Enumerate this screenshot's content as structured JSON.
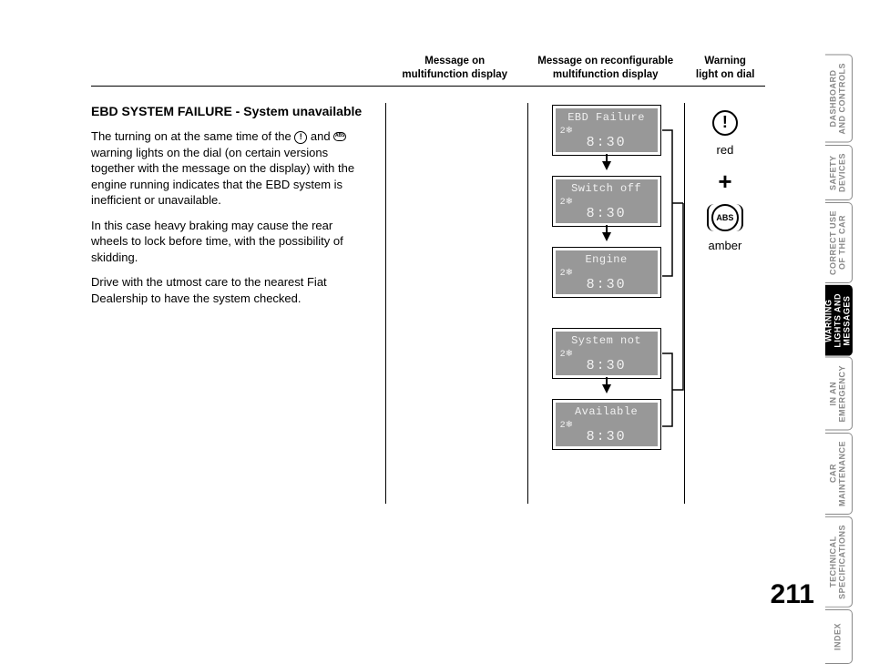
{
  "headers": {
    "col1": "Message on\nmultifunction display",
    "col2": "Message on reconfigurable\nmultifunction display",
    "col3": "Warning\nlight on dial"
  },
  "section": {
    "title": "EBD SYSTEM FAILURE - System unavailable",
    "para1_a": "The turning on at the same time of the ",
    "para1_b": " and ",
    "para1_c": " warning lights on the dial (on certain versions together with the message on the display) with the engine running indicates that the EBD system is inefficient or unavailable.",
    "para2": "In this case heavy braking may cause the rear wheels to lock before time, with the possibility of skidding.",
    "para3": "Drive with the utmost care to the nearest Fiat Dealership to have the system checked."
  },
  "lcd": {
    "group1": [
      {
        "title": "EBD Failure",
        "sub": "2❄",
        "time": "8:30"
      },
      {
        "title": "Switch off",
        "sub": "2❄",
        "time": "8:30"
      },
      {
        "title": "Engine",
        "sub": "2❄",
        "time": "8:30"
      }
    ],
    "group2": [
      {
        "title": "System not",
        "sub": "2❄",
        "time": "8:30"
      },
      {
        "title": "Available",
        "sub": "2❄",
        "time": "8:30"
      }
    ]
  },
  "warnings": {
    "icon1_glyph": "!",
    "label1": "red",
    "plus": "+",
    "icon2_text": "ABS",
    "label2": "amber"
  },
  "tabs": [
    {
      "label": "DASHBOARD\nAND CONTROLS",
      "active": false
    },
    {
      "label": "SAFETY\nDEVICES",
      "active": false
    },
    {
      "label": "CORRECT USE\nOF THE CAR",
      "active": false
    },
    {
      "label": "WARNING\nLIGHTS AND\nMESSAGES",
      "active": true
    },
    {
      "label": "IN AN\nEMERGENCY",
      "active": false
    },
    {
      "label": "CAR\nMAINTENANCE",
      "active": false
    },
    {
      "label": "TECHNICAL\nSPECIFICATIONS",
      "active": false
    },
    {
      "label": "INDEX",
      "active": false
    }
  ],
  "page_number": "211"
}
